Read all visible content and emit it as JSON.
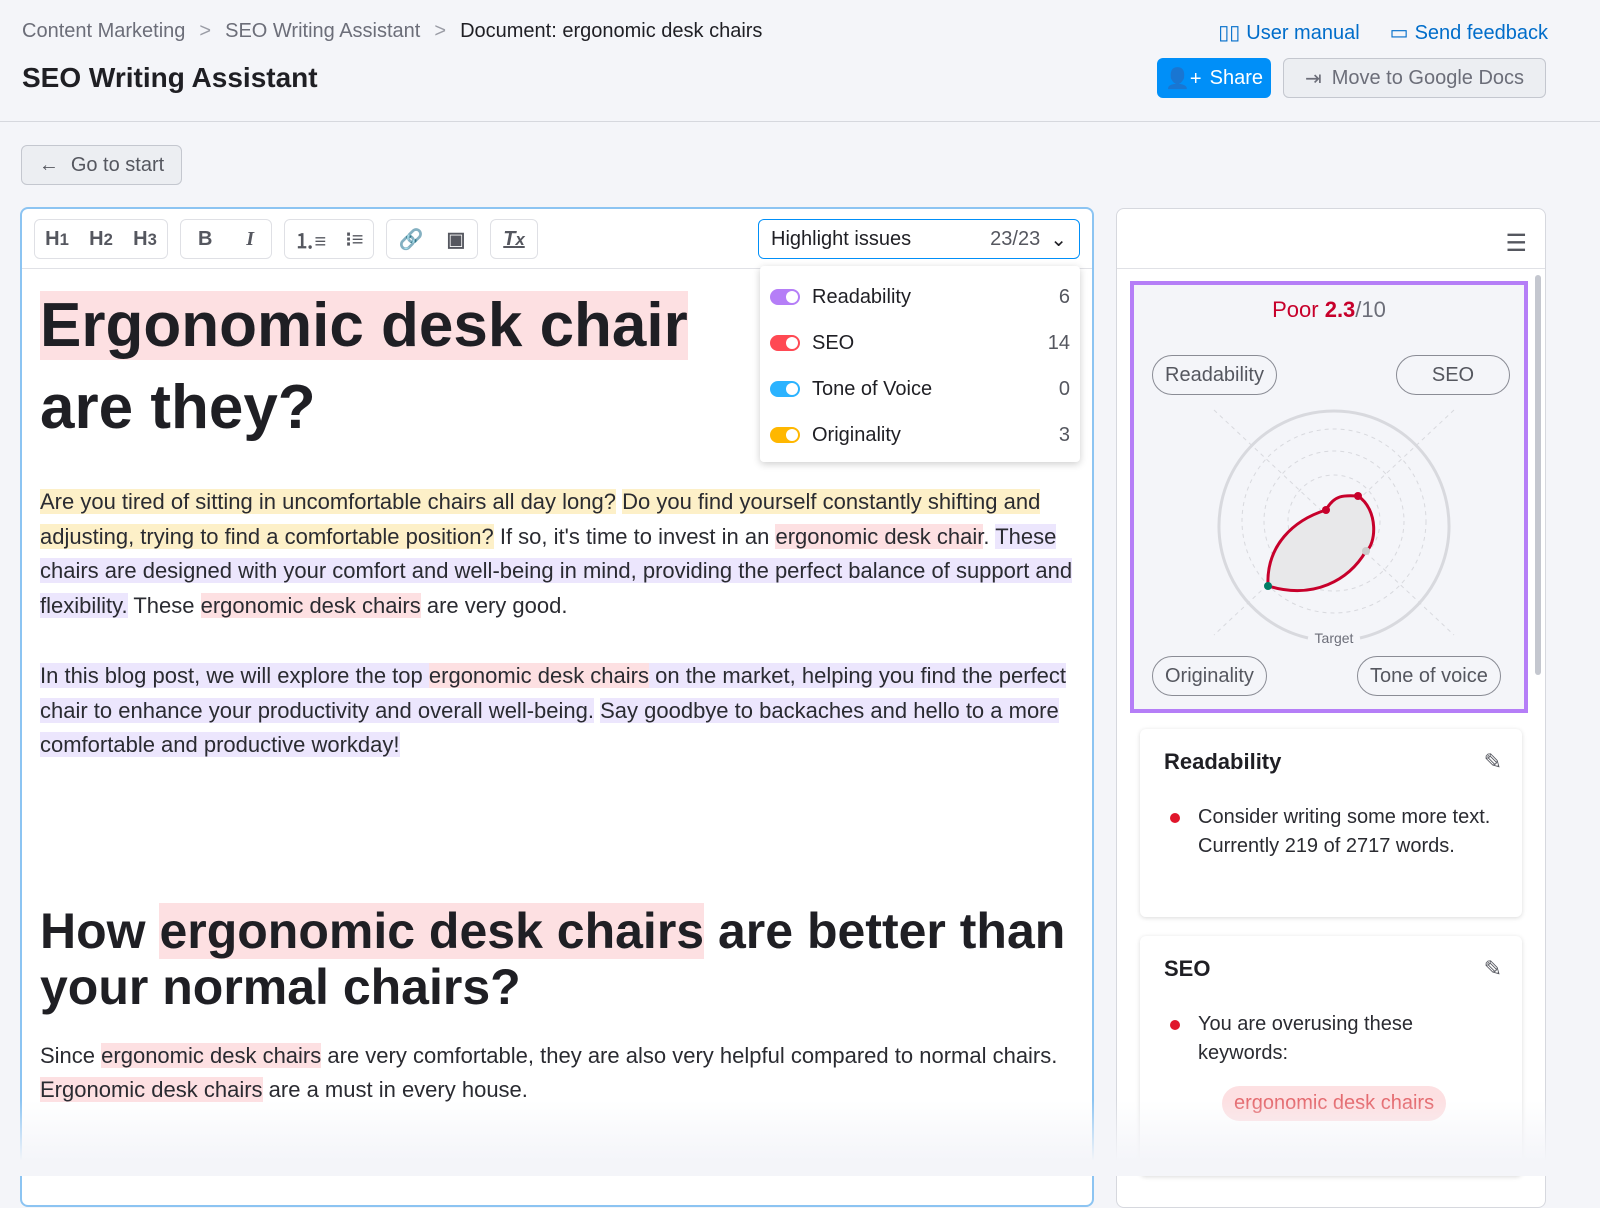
{
  "breadcrumbs": [
    "Content Marketing",
    "SEO Writing Assistant",
    "Document: ergonomic desk chairs"
  ],
  "header": {
    "title": "SEO Writing Assistant",
    "user_manual": "User manual",
    "send_feedback": "Send feedback",
    "share": "Share",
    "move": "Move to Google Docs"
  },
  "back": "Go to start",
  "toolbar": {
    "h1": "H1",
    "h2": "H2",
    "h3": "H3",
    "bold": "B",
    "italic": "I",
    "highlight_label": "Highlight issues",
    "highlight_count": "23/23"
  },
  "issues": [
    {
      "label": "Readability",
      "count": "6",
      "color": "#b57ef7"
    },
    {
      "label": "SEO",
      "count": "14",
      "color": "#ff4953"
    },
    {
      "label": "Tone of Voice",
      "count": "0",
      "color": "#2bb3ff"
    },
    {
      "label": "Originality",
      "count": "3",
      "color": "#ffb700"
    }
  ],
  "doc": {
    "h1": [
      "Ergonomic desk chair",
      "are they?"
    ],
    "p1": [
      "Are you tired of sitting in uncomfortable chairs all day long?",
      " ",
      "Do you find yourself constantly shifting and adjusting, trying to find a comfortable position?",
      " If so, it's time to invest in an ",
      "ergonomic desk chair",
      ". ",
      "These chairs are designed with your comfort and well-being in mind, providing the perfect balance of support and flexibility.",
      " These ",
      "ergonomic desk chairs",
      " are very good."
    ],
    "p2": [
      "In this blog post, we will explore the top ",
      "ergonomic desk chairs",
      " on the market, helping you find the perfect chair to enhance your productivity and overall well-being.",
      " ",
      "Say goodbye to backaches and hello to a more comfortable and productive workday!"
    ],
    "h2": [
      "How ",
      "ergonomic desk chairs",
      " are better than your normal chairs?"
    ],
    "p3": [
      "Since ",
      "ergonomic desk chairs",
      " are very comfortable, they are also very helpful compared to normal chairs. ",
      "Ergonomic desk chairs",
      " are a must in every house."
    ]
  },
  "score": {
    "label": "Poor",
    "value": "2.3",
    "max": "/10",
    "target": "Target",
    "axes": [
      "Readability",
      "SEO",
      "Originality",
      "Tone of voice"
    ]
  },
  "cards": [
    {
      "title": "Readability",
      "items": [
        "Consider writing some more text. Currently 219 of 2717 words."
      ]
    },
    {
      "title": "SEO",
      "items": [
        "You are overusing these keywords:"
      ],
      "keyword": "ergonomic desk chairs"
    }
  ]
}
